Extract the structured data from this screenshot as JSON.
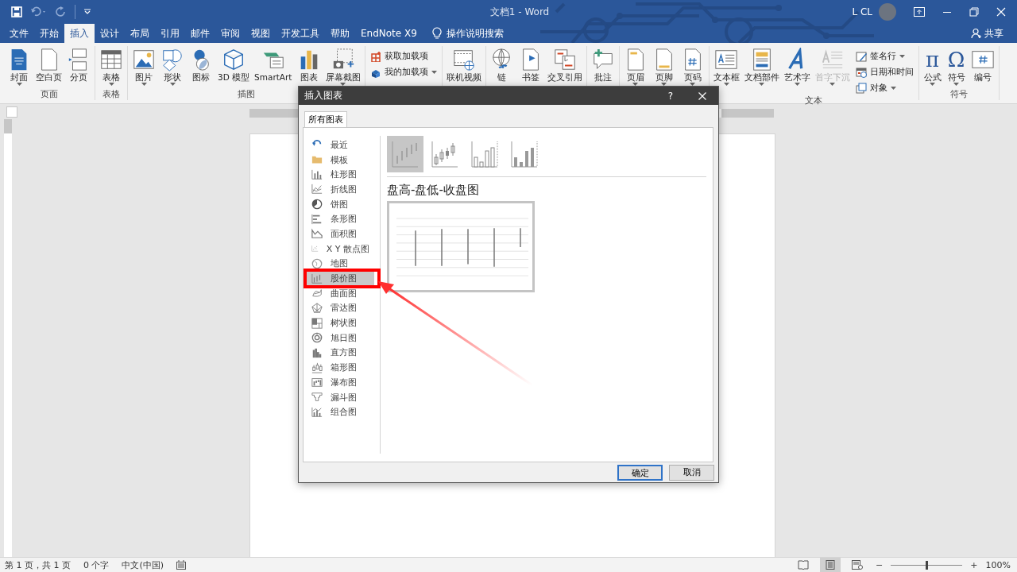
{
  "title_bar": {
    "title": "文档1 - Word",
    "user": "L CL"
  },
  "tabs": [
    {
      "label": "文件",
      "selected": false
    },
    {
      "label": "开始",
      "selected": false
    },
    {
      "label": "插入",
      "selected": true
    },
    {
      "label": "设计",
      "selected": false
    },
    {
      "label": "布局",
      "selected": false
    },
    {
      "label": "引用",
      "selected": false
    },
    {
      "label": "邮件",
      "selected": false
    },
    {
      "label": "审阅",
      "selected": false
    },
    {
      "label": "视图",
      "selected": false
    },
    {
      "label": "开发工具",
      "selected": false
    },
    {
      "label": "帮助",
      "selected": false
    },
    {
      "label": "EndNote X9",
      "selected": false
    }
  ],
  "search": {
    "label": "操作说明搜索"
  },
  "share": {
    "label": "共享"
  },
  "ribbon": {
    "groups": [
      {
        "label": "页面",
        "items": [
          {
            "label": "封面",
            "kind": "large",
            "dropdown": true,
            "disabled": false
          },
          {
            "label": "空白页",
            "kind": "large",
            "dropdown": false,
            "disabled": false
          },
          {
            "label": "分页",
            "kind": "large",
            "dropdown": false,
            "disabled": false
          }
        ]
      },
      {
        "label": "表格",
        "items": [
          {
            "label": "表格",
            "kind": "large",
            "dropdown": true,
            "disabled": false
          }
        ]
      },
      {
        "label": "插图",
        "items": [
          {
            "label": "图片",
            "kind": "large",
            "dropdown": true,
            "disabled": false
          },
          {
            "label": "形状",
            "kind": "large",
            "dropdown": true,
            "disabled": false
          },
          {
            "label": "图标",
            "kind": "large",
            "dropdown": false,
            "disabled": false
          },
          {
            "label": "3D 模型",
            "kind": "large",
            "dropdown": false,
            "disabled": false
          },
          {
            "label": "SmartArt",
            "kind": "large",
            "dropdown": false,
            "disabled": false
          },
          {
            "label": "图表",
            "kind": "large",
            "dropdown": false,
            "disabled": false
          },
          {
            "label": "屏幕截图",
            "kind": "large",
            "dropdown": true,
            "disabled": false
          }
        ]
      },
      {
        "items": [
          {
            "label": "获取加载项",
            "kind": "small",
            "dropdown": false,
            "disabled": false
          },
          {
            "label": "我的加载项",
            "kind": "small",
            "dropdown": true,
            "disabled": false
          }
        ]
      },
      {
        "items": [
          {
            "label": "联机视频",
            "kind": "large",
            "dropdown": false,
            "disabled": false
          }
        ]
      },
      {
        "items": [
          {
            "label": "链",
            "kind": "large",
            "dropdown": false,
            "disabled": false
          },
          {
            "label": "书签",
            "kind": "large",
            "dropdown": false,
            "disabled": false
          },
          {
            "label": "交叉引用",
            "kind": "large",
            "dropdown": false,
            "disabled": false
          }
        ]
      },
      {
        "items": [
          {
            "label": "批注",
            "kind": "large",
            "dropdown": false,
            "disabled": false
          }
        ]
      },
      {
        "items": [
          {
            "label": "页眉",
            "kind": "large",
            "dropdown": true,
            "disabled": false
          },
          {
            "label": "页脚",
            "kind": "large",
            "dropdown": true,
            "disabled": false
          },
          {
            "label": "页码",
            "kind": "large",
            "dropdown": true,
            "disabled": false
          }
        ]
      },
      {
        "label": "文本",
        "items": [
          {
            "label": "文本框",
            "kind": "large",
            "dropdown": true,
            "disabled": false
          },
          {
            "label": "文档部件",
            "kind": "large",
            "dropdown": true,
            "disabled": false
          },
          {
            "label": "艺术字",
            "kind": "large",
            "dropdown": true,
            "disabled": false
          },
          {
            "label": "首字下沉",
            "kind": "large",
            "dropdown": true,
            "disabled": true
          },
          {
            "label": "签名行",
            "kind": "small",
            "dropdown": true,
            "disabled": false
          },
          {
            "label": "日期和时间",
            "kind": "small",
            "dropdown": false,
            "disabled": false
          },
          {
            "label": "对象",
            "kind": "small",
            "dropdown": true,
            "disabled": false
          }
        ]
      },
      {
        "label": "符号",
        "items": [
          {
            "label": "公式",
            "kind": "large",
            "glyph": "π",
            "dropdown": true,
            "disabled": false
          },
          {
            "label": "符号",
            "kind": "large",
            "glyph": "Ω",
            "dropdown": true,
            "disabled": false
          },
          {
            "label": "编号",
            "kind": "large",
            "dropdown": false,
            "disabled": false
          }
        ]
      }
    ]
  },
  "dialog": {
    "title": "插入图表",
    "help": "?",
    "tab": {
      "label": "所有图表",
      "selected": true
    },
    "categories": [
      {
        "label": "最近",
        "selected": false,
        "highlighted": false
      },
      {
        "label": "模板",
        "selected": false,
        "highlighted": false
      },
      {
        "label": "柱形图",
        "selected": false,
        "highlighted": false
      },
      {
        "label": "折线图",
        "selected": false,
        "highlighted": false
      },
      {
        "label": "饼图",
        "selected": false,
        "highlighted": false
      },
      {
        "label": "条形图",
        "selected": false,
        "highlighted": false
      },
      {
        "label": "面积图",
        "selected": false,
        "highlighted": false
      },
      {
        "label": "X Y 散点图",
        "selected": false,
        "highlighted": false
      },
      {
        "label": "地图",
        "selected": false,
        "highlighted": false
      },
      {
        "label": "股价图",
        "selected": true,
        "highlighted": true
      },
      {
        "label": "曲面图",
        "selected": false,
        "highlighted": false
      },
      {
        "label": "雷达图",
        "selected": false,
        "highlighted": false
      },
      {
        "label": "树状图",
        "selected": false,
        "highlighted": false
      },
      {
        "label": "旭日图",
        "selected": false,
        "highlighted": false
      },
      {
        "label": "直方图",
        "selected": false,
        "highlighted": false
      },
      {
        "label": "箱形图",
        "selected": false,
        "highlighted": false
      },
      {
        "label": "瀑布图",
        "selected": false,
        "highlighted": false
      },
      {
        "label": "漏斗图",
        "selected": false,
        "highlighted": false
      },
      {
        "label": "组合图",
        "selected": false,
        "highlighted": false
      }
    ],
    "subtypes": [
      {
        "selected": true
      },
      {
        "selected": false
      },
      {
        "selected": false
      },
      {
        "selected": false
      }
    ],
    "subtype_title": "盘高-盘低-收盘图",
    "buttons": [
      {
        "label": "确定",
        "default": true
      },
      {
        "label": "取消",
        "default": false
      }
    ]
  },
  "status_bar": {
    "page": "第 1 页，共 1 页",
    "words": "0 个字",
    "language": "中文(中国)",
    "zoom": {
      "minus": "−",
      "plus": "+",
      "level": 0.5,
      "reading": "100%"
    }
  }
}
